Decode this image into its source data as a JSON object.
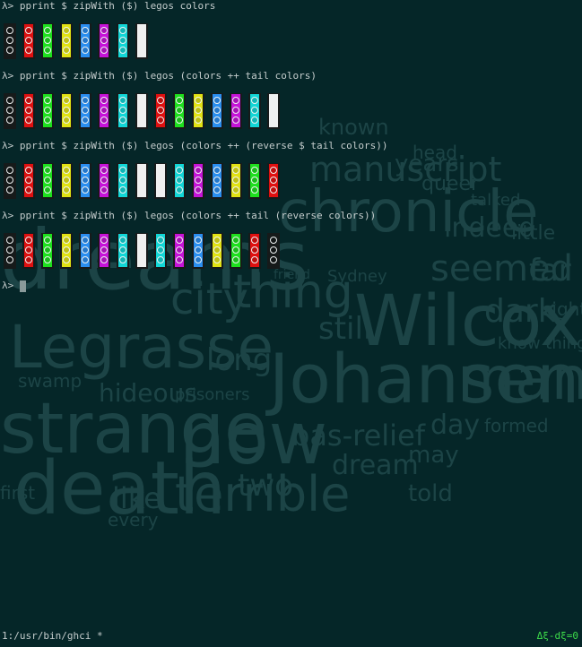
{
  "colors": {
    "black": "#1e2020",
    "red": "#e01010",
    "green": "#1ee01e",
    "yellow": "#e2e213",
    "blue": "#2a8ef0",
    "magenta": "#c613d8",
    "cyan": "#12d6d6",
    "white": "#f0f0f0"
  },
  "sessions": [
    {
      "prompt": "λ> pprint $ zipWith ($) legos colors",
      "bricks": [
        "black",
        "red",
        "green",
        "yellow",
        "blue",
        "magenta",
        "cyan",
        "white"
      ]
    },
    {
      "prompt": "λ> pprint $ zipWith ($) legos (colors ++ tail colors)",
      "bricks": [
        "black",
        "red",
        "green",
        "yellow",
        "blue",
        "magenta",
        "cyan",
        "white",
        "red",
        "green",
        "yellow",
        "blue",
        "magenta",
        "cyan",
        "white"
      ]
    },
    {
      "prompt": "λ> pprint $ zipWith ($) legos (colors ++ (reverse $ tail colors))",
      "bricks": [
        "black",
        "red",
        "green",
        "yellow",
        "blue",
        "magenta",
        "cyan",
        "white",
        "white",
        "cyan",
        "magenta",
        "blue",
        "yellow",
        "green",
        "red"
      ]
    },
    {
      "prompt": "λ> pprint $ zipWith ($) legos (colors ++ tail (reverse colors))",
      "bricks": [
        "black",
        "red",
        "green",
        "yellow",
        "blue",
        "magenta",
        "cyan",
        "white",
        "cyan",
        "magenta",
        "blue",
        "yellow",
        "green",
        "red",
        "black"
      ]
    }
  ],
  "current_prompt": "λ>",
  "status": {
    "left": "1:/usr/bin/ghci *",
    "right": "Δξ-dξ=0"
  },
  "background_words": [
    {
      "text": "known"
    },
    {
      "text": "head"
    },
    {
      "text": "manuscript"
    },
    {
      "text": "years"
    },
    {
      "text": "queer"
    },
    {
      "text": "talked"
    },
    {
      "text": "indeed"
    },
    {
      "text": "little"
    },
    {
      "text": "chronicle"
    },
    {
      "text": "Sydney"
    },
    {
      "text": "friend"
    },
    {
      "text": "seemed"
    },
    {
      "text": "far"
    },
    {
      "text": "dreams"
    },
    {
      "text": "city"
    },
    {
      "text": "thing"
    },
    {
      "text": "Wilcox"
    },
    {
      "text": "dark"
    },
    {
      "text": "sight"
    },
    {
      "text": "still"
    },
    {
      "text": "Legrasse"
    },
    {
      "text": "long"
    },
    {
      "text": "know things"
    },
    {
      "text": "Johansen"
    },
    {
      "text": "man"
    },
    {
      "text": "swamp"
    },
    {
      "text": "hideous"
    },
    {
      "text": "prisoners"
    },
    {
      "text": "strange"
    },
    {
      "text": "now"
    },
    {
      "text": "bas-relief"
    },
    {
      "text": "day"
    },
    {
      "text": "formed"
    },
    {
      "text": "dream"
    },
    {
      "text": "may"
    },
    {
      "text": "told"
    },
    {
      "text": "death"
    },
    {
      "text": "like"
    },
    {
      "text": "terrible"
    },
    {
      "text": "two"
    },
    {
      "text": "every"
    },
    {
      "text": "first"
    }
  ]
}
